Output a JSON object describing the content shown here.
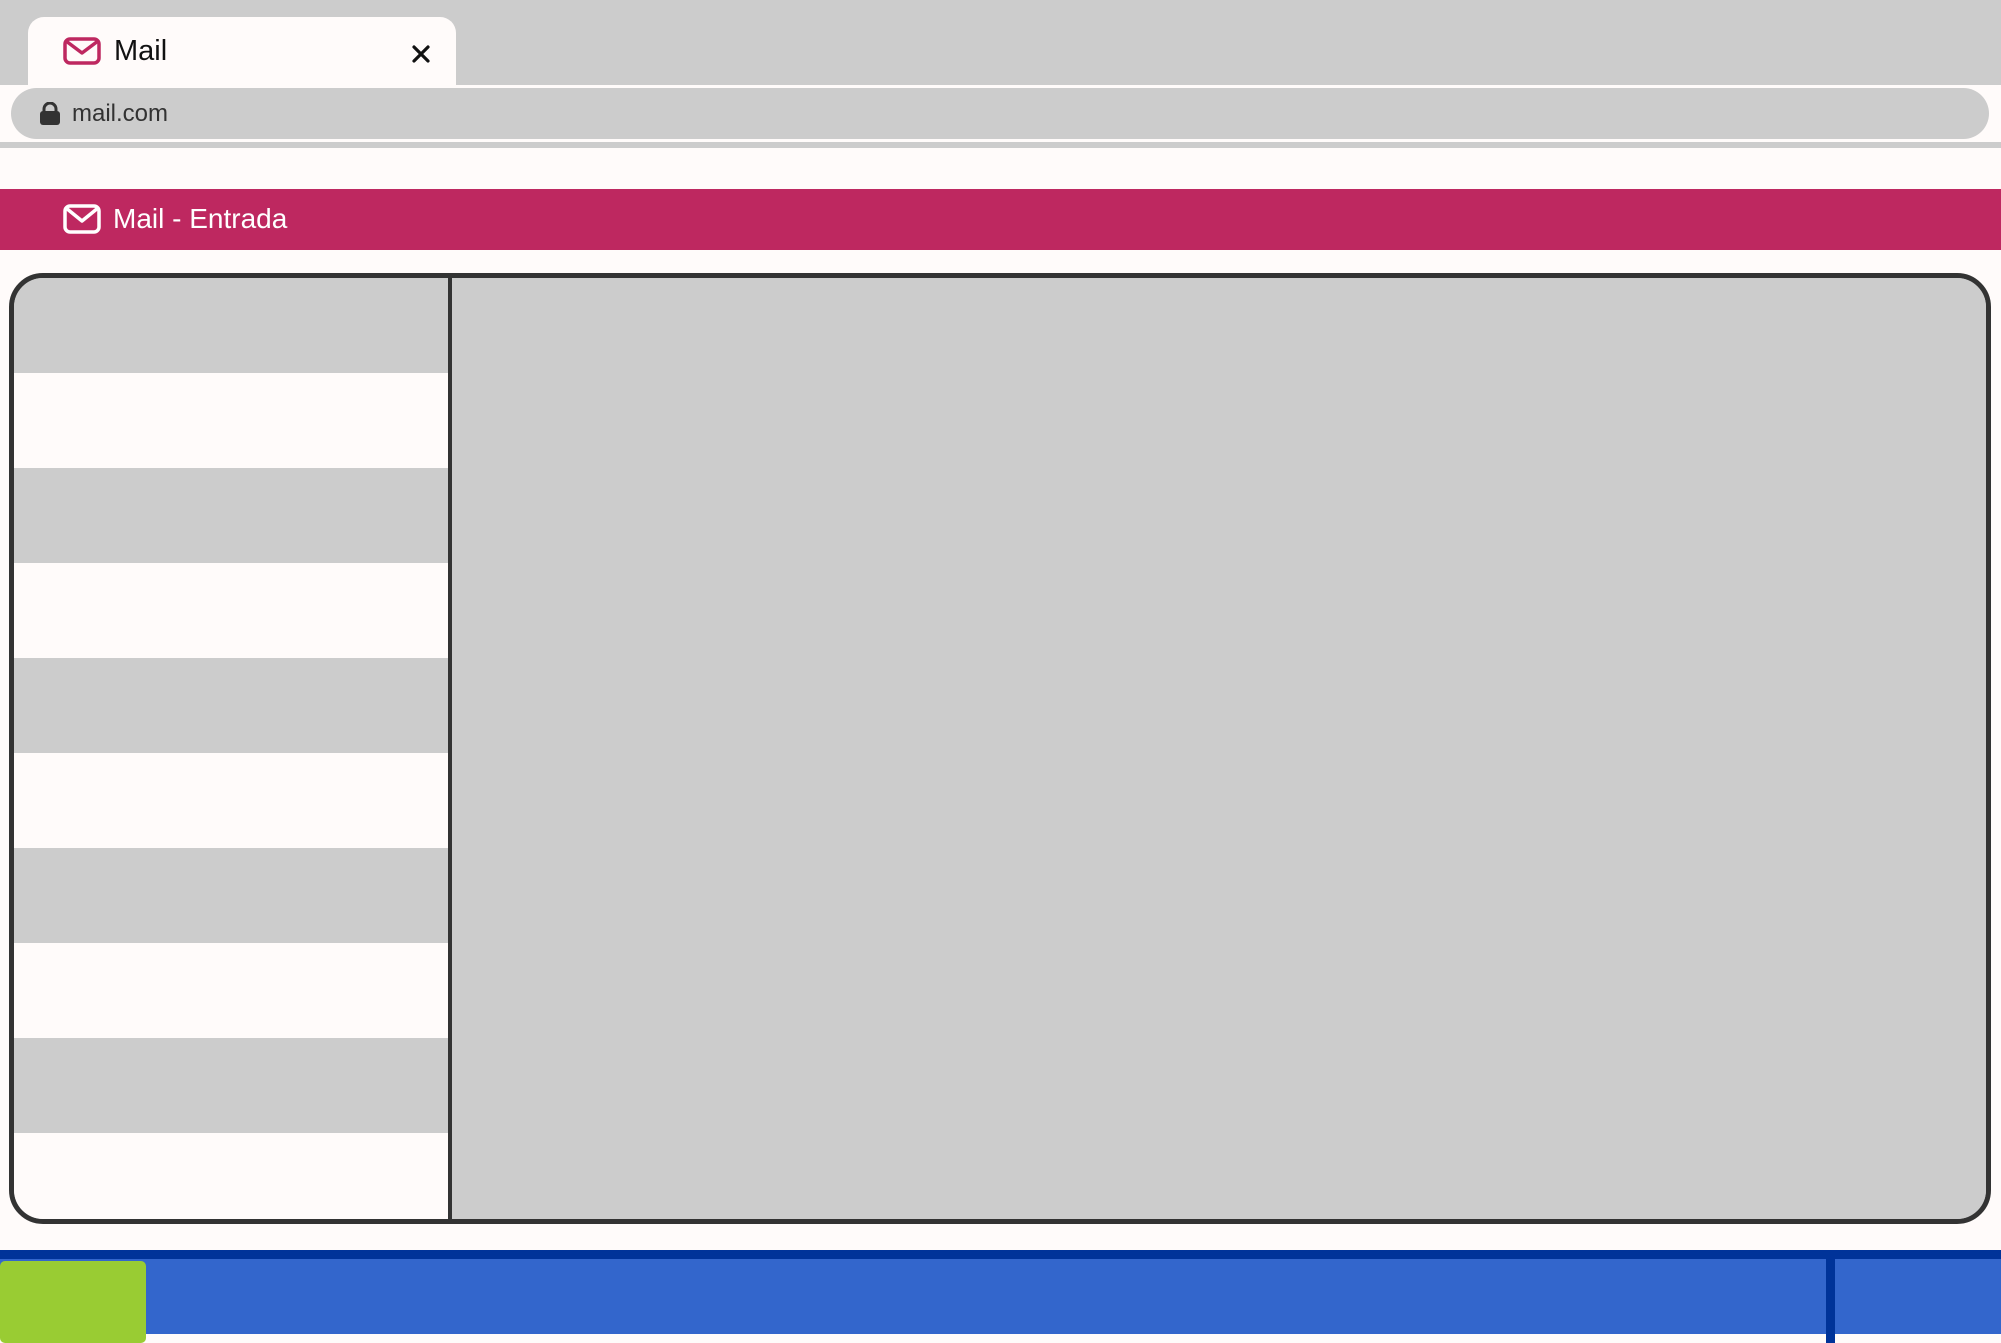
{
  "browser": {
    "tab": {
      "title": "Mail",
      "icon": "mail-icon",
      "close_icon": "close-icon"
    },
    "address_bar": {
      "url": "mail.com",
      "icon": "lock-icon"
    }
  },
  "app": {
    "header": {
      "title": "Mail - Entrada",
      "icon": "mail-icon"
    },
    "message_list": {
      "row_count": 10
    }
  },
  "taskbar": {
    "start_button": "start-button"
  },
  "colors": {
    "brand": "#be2860",
    "chrome_gray": "#cccccc",
    "page_background": "#fffbfa",
    "border_dark": "#333333",
    "taskbar_blue": "#3366cc",
    "taskbar_dark_blue": "#003399",
    "start_green": "#99cc33"
  }
}
